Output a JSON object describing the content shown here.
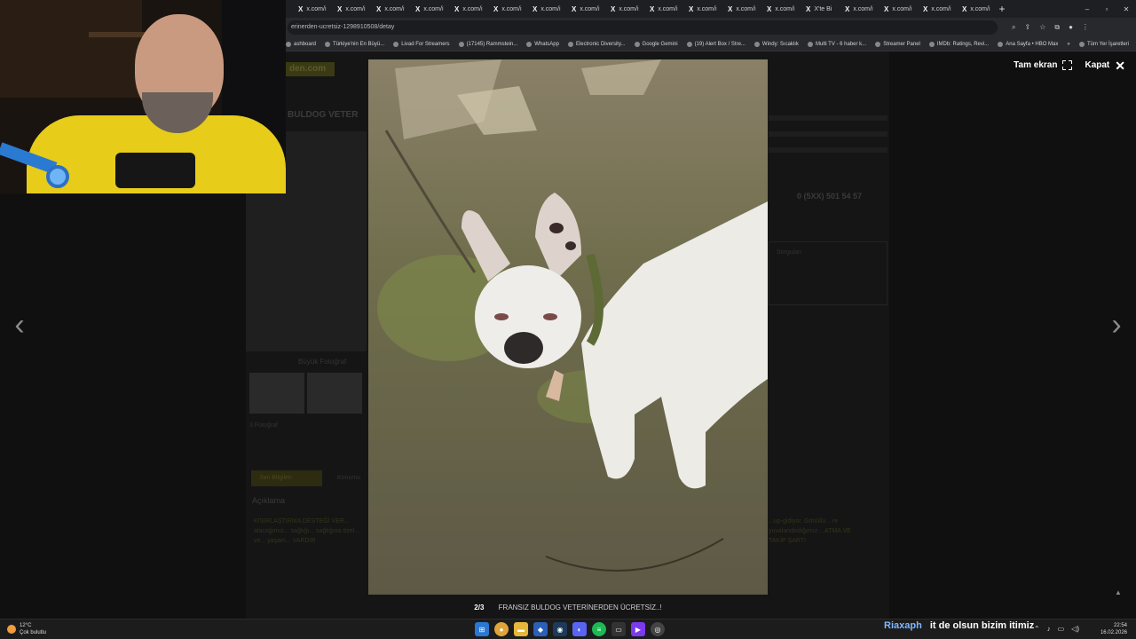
{
  "browser": {
    "tabs": [
      "x.com/i",
      "x.com/i",
      "x.com/i",
      "x.com/i",
      "x.com/i",
      "x.com/i",
      "x.com/i",
      "x.com/i",
      "x.com/i",
      "x.com/i",
      "x.com/i",
      "x.com/i",
      "x.com/i",
      "X'te Bi",
      "x.com/i",
      "x.com/i",
      "x.com/i",
      "x.com/i"
    ],
    "new_tab_label": "+",
    "url": "erinerden-ucretsiz-1298910508/detay",
    "bookmarks": [
      "ashboard",
      "Türkiye'nin En Büyü...",
      "Livad For Streamers",
      "(17145) Rammstein...",
      "WhatsApp",
      "Electronic Diversity...",
      "Google Gemini",
      "(19) Alert Box / Stre...",
      "Windy: Sıcaklık",
      "Multi TV - 6 haber k...",
      "Streamer Panel",
      "IMDb: Ratings, Revi...",
      "Ana Sayfa • HBO Max"
    ],
    "bookmarks_more": "»",
    "all_bookmarks": "Tüm Yer İşaretleri",
    "window_controls": [
      "–",
      "▫",
      "✕"
    ]
  },
  "background_page": {
    "logo": "den.com",
    "title": "BULDOG VETER",
    "photo_caption": "Büyük Fotoğraf",
    "thumb_count": "3 Fotoğraf",
    "tab_active": "İlan Bilgileri",
    "tab_other": "Konumu",
    "desc_heading": "Açıklama",
    "desc_left": "KISIRLAŞTIRMA DESTEĞİ VER... alacağımız... sağlığı... sağlığına özel... ve... yaşam... VARDIR",
    "desc_right": "...up-gidiyor. Gönüllü ...re yuvalandırdığımız ...ATMA VE TAKİP ŞARTI",
    "phone": "0 (5XX) 501 54 57",
    "panel_title": "Sorgulan"
  },
  "lightbox": {
    "fullscreen_label": "Tam ekran",
    "close_label": "Kapat",
    "counter": "2/3",
    "title": "FRANSIZ BULDOG VETERİNERDEN ÜCRETSİZ..!",
    "prev": "‹",
    "next": "›"
  },
  "taskbar": {
    "weather_temp": "12°C",
    "weather_desc": "Çok bulutlu",
    "overlay_name": "Riaxaph",
    "overlay_message": "it de olsun bizim itimiz",
    "time": "22:54",
    "date": "16.02.2026"
  },
  "colors": {
    "brand_yellow": "#e8cc1a",
    "dim_bg": "#101010"
  }
}
